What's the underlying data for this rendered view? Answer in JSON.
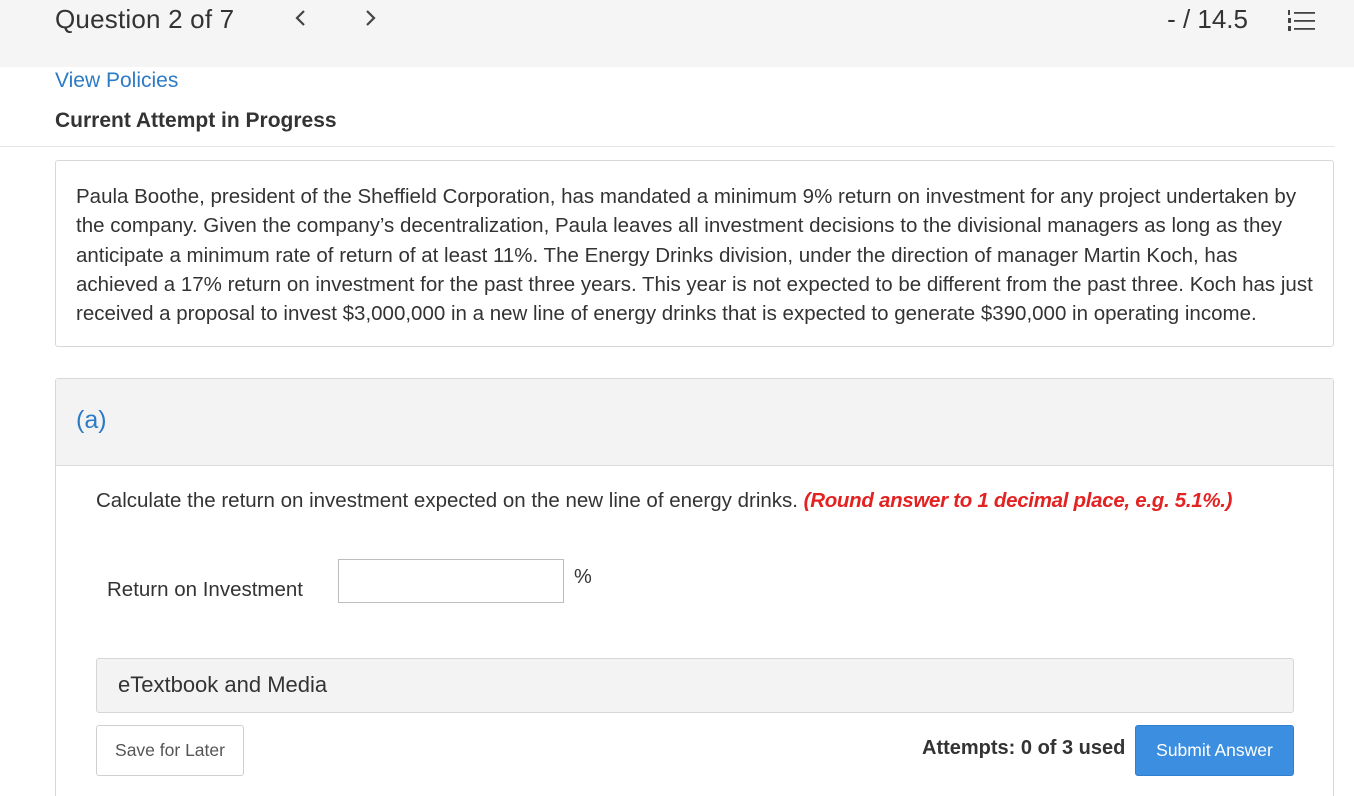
{
  "header": {
    "question_counter": "Question 2 of 7",
    "prev_icon": "chevron-left-icon",
    "next_icon": "chevron-right-icon",
    "score": "- / 14.5",
    "menu_icon": "numbered-list-icon"
  },
  "policy": {
    "view_policies_link": "View Policies",
    "attempt_status": "Current Attempt in Progress"
  },
  "question": {
    "text": "Paula Boothe, president of the Sheffield Corporation, has mandated a minimum 9% return on investment for any project undertaken by the company. Given the company’s decentralization, Paula leaves all investment decisions to the divisional managers as long as they anticipate a minimum rate of return of at least 11%. The Energy Drinks division, under the direction of manager Martin Koch, has achieved a 17% return on investment for the past three years. This year is not expected to be different from the past three. Koch has just received a proposal to invest $3,000,000 in a new line of energy drinks that is expected to generate $390,000 in operating income."
  },
  "part_a": {
    "label": "(a)",
    "instruction": "Calculate the return on investment expected on the new line of energy drinks.",
    "hint": "(Round answer to 1 decimal place, e.g. 5.1%.)",
    "field_label": "Return on Investment",
    "field_value": "",
    "unit": "%",
    "etextbook": "eTextbook and Media",
    "save_label": "Save for Later",
    "attempts": "Attempts: 0 of 3 used",
    "submit_label": "Submit Answer"
  },
  "colors": {
    "link_blue": "#2d7bc4",
    "hint_red": "#e32222",
    "submit_blue": "#3b8ee0"
  }
}
